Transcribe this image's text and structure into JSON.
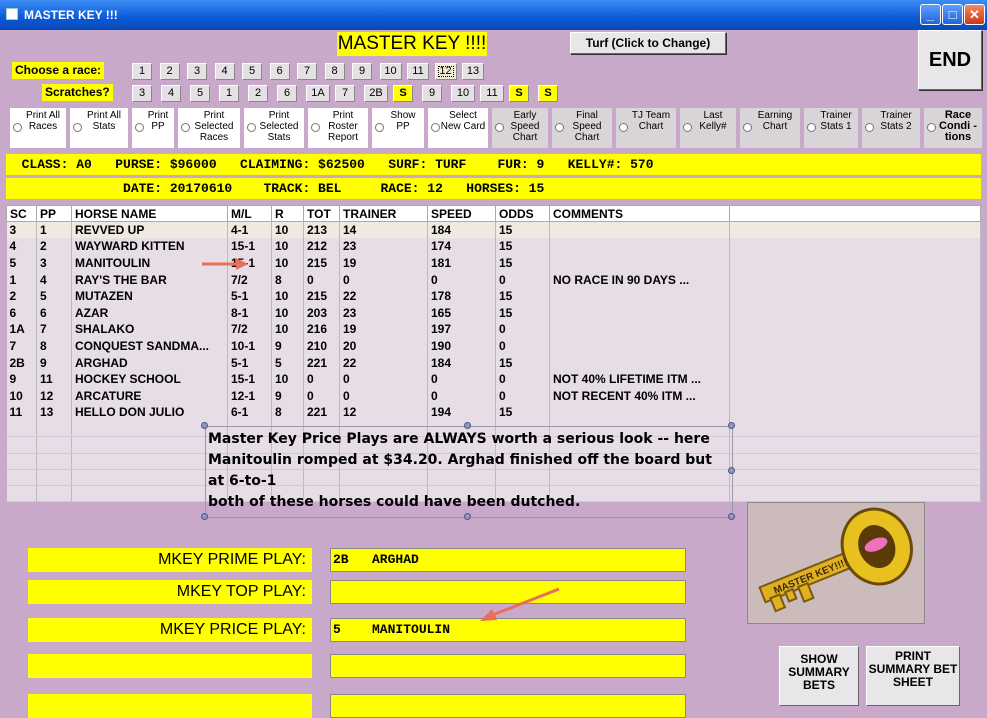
{
  "window": {
    "title": "MASTER KEY !!!"
  },
  "header": {
    "title": "MASTER KEY !!!!",
    "turf_button": "Turf (Click to Change)",
    "end_button": "END"
  },
  "race_chooser": {
    "label": "Choose  a race:",
    "races": [
      "1",
      "2",
      "3",
      "4",
      "5",
      "6",
      "7",
      "8",
      "9",
      "10",
      "11",
      "12",
      "13"
    ],
    "selected": "12"
  },
  "scratches": {
    "label": "Scratches?",
    "items": [
      "3",
      "4",
      "5",
      "1",
      "2",
      "6",
      "1A",
      "7",
      "2B",
      "S",
      "9",
      "10",
      "11",
      "S",
      "S"
    ]
  },
  "options": [
    {
      "label": "Print All Races"
    },
    {
      "label": "Print All Stats"
    },
    {
      "label": "Print PP"
    },
    {
      "label": "Print Selected Races"
    },
    {
      "label": "Print Selected Stats"
    },
    {
      "label": "Print Roster Report"
    },
    {
      "label": "Show PP"
    },
    {
      "label": "Select New Card"
    },
    {
      "label": "Early Speed Chart"
    },
    {
      "label": "Final Speed Chart"
    },
    {
      "label": "TJ Team Chart"
    },
    {
      "label": "Last Kelly#"
    },
    {
      "label": "Earning Chart"
    },
    {
      "label": "Trainer Stats 1"
    },
    {
      "label": "Trainer Stats 2"
    },
    {
      "label": "Race Condi -tions"
    }
  ],
  "race_info": {
    "line1": "  CLASS: A0   PURSE: $96000   CLAIMING: $62500   SURF: TURF    FUR: 9   KELLY#: 570",
    "line2": "               DATE: 20170610    TRACK: BEL     RACE: 12   HORSES: 15"
  },
  "table": {
    "columns": [
      "SC",
      "PP",
      "HORSE NAME",
      "M/L",
      "R",
      "TOT",
      "TRAINER",
      "SPEED",
      "ODDS",
      "COMMENTS"
    ],
    "rows": [
      [
        "3",
        "1",
        "REVVED UP",
        "4-1",
        "10",
        "213",
        "14",
        "184",
        "15",
        ""
      ],
      [
        "4",
        "2",
        "WAYWARD KITTEN",
        "15-1",
        "10",
        "212",
        "23",
        "174",
        "15",
        ""
      ],
      [
        "5",
        "3",
        "MANITOULIN",
        "15-1",
        "10",
        "215",
        "19",
        "181",
        "15",
        ""
      ],
      [
        "1",
        "4",
        "RAY'S THE BAR",
        "7/2",
        "8",
        "0",
        "0",
        "0",
        "0",
        "NO RACE IN 90 DAYS     ..."
      ],
      [
        "2",
        "5",
        "MUTAZEN",
        "5-1",
        "10",
        "215",
        "22",
        "178",
        "15",
        ""
      ],
      [
        "6",
        "6",
        "AZAR",
        "8-1",
        "10",
        "203",
        "23",
        "165",
        "15",
        ""
      ],
      [
        "1A",
        "7",
        "SHALAKO",
        "7/2",
        "10",
        "216",
        "19",
        "197",
        "0",
        ""
      ],
      [
        "7",
        "8",
        "CONQUEST SANDMA...",
        "10-1",
        "9",
        "210",
        "20",
        "190",
        "0",
        ""
      ],
      [
        "2B",
        "9",
        "ARGHAD",
        "5-1",
        "5",
        "221",
        "22",
        "184",
        "15",
        ""
      ],
      [
        "9",
        "11",
        "HOCKEY SCHOOL",
        "15-1",
        "10",
        "0",
        "0",
        "0",
        "0",
        "NOT 40% LIFETIME ITM  ..."
      ],
      [
        "10",
        "12",
        "ARCATURE",
        "12-1",
        "9",
        "0",
        "0",
        "0",
        "0",
        "NOT RECENT 40% ITM    ..."
      ],
      [
        "11",
        "13",
        "HELLO DON JULIO",
        "6-1",
        "8",
        "221",
        "12",
        "194",
        "15",
        ""
      ]
    ]
  },
  "note": {
    "line1": "Master Key Price Plays are ALWAYS worth a serious look -- here",
    "line2": "Manitoulin romped at $34.20.  Arghad finished off the board but at 6-to-1",
    "line3": "both of these horses could have been dutched."
  },
  "plays": {
    "prime_label": "MKEY PRIME PLAY:",
    "prime_value": "2B   ARGHAD",
    "top_label": "MKEY TOP PLAY:",
    "top_value": "",
    "price_label": "MKEY PRICE PLAY:",
    "price_value": "5    MANITOULIN"
  },
  "logo": {
    "text": "MASTER KEY!!!!"
  },
  "buttons": {
    "show_summary": "SHOW SUMMARY BETS",
    "print_summary": "PRINT SUMMARY BET SHEET"
  },
  "colors": {
    "accent": "#ffff00",
    "background": "#c9a9c9",
    "arrow": "#e8705a"
  }
}
